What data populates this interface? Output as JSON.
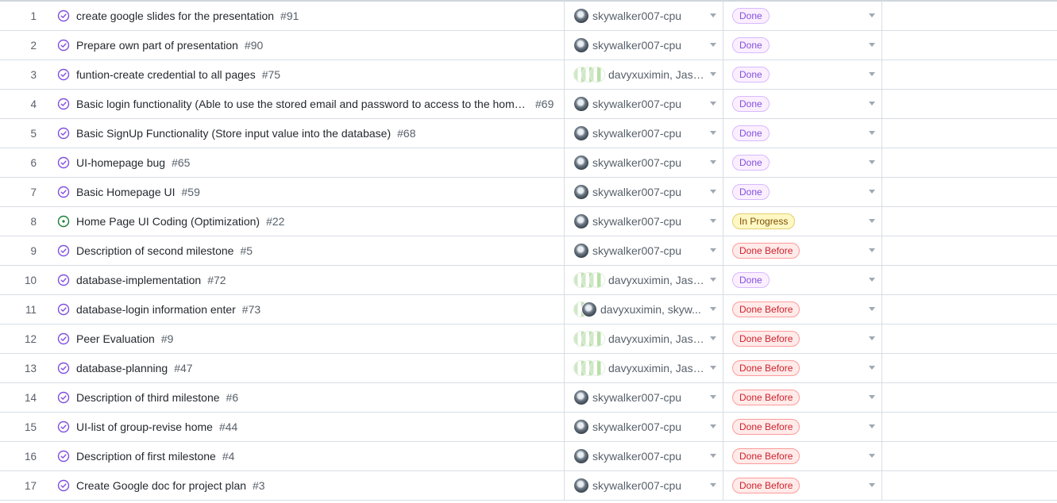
{
  "colors": {
    "done_bg": "#fbefff",
    "done_border": "#d8b9ff",
    "done_text": "#8250df",
    "progress_bg": "#fff8c5",
    "progress_border": "#e3cf6b",
    "progress_text": "#7d4e00",
    "before_bg": "#ffebe9",
    "before_border": "#ff9b9b",
    "before_text": "#cf222e",
    "closed_icon": "#8250df",
    "open_icon": "#1a7f37"
  },
  "rows": [
    {
      "num": "1",
      "title": "create google slides for the presentation",
      "issue": "#91",
      "state": "closed",
      "avatar": "sky",
      "assignee": "skywalker007-cpu",
      "status": "Done",
      "status_key": "done"
    },
    {
      "num": "2",
      "title": "Prepare own part of presentation",
      "issue": "#90",
      "state": "closed",
      "avatar": "sky",
      "assignee": "skywalker007-cpu",
      "status": "Done",
      "status_key": "done"
    },
    {
      "num": "3",
      "title": "funtion-create credential to all pages",
      "issue": "#75",
      "state": "closed",
      "avatar": "davy-multi",
      "assignee": "davyxuximin, Jases...",
      "status": "Done",
      "status_key": "done"
    },
    {
      "num": "4",
      "title": "Basic login functionality (Able to use the stored email and password to access to the home...",
      "issue": "#69",
      "state": "closed",
      "avatar": "sky",
      "assignee": "skywalker007-cpu",
      "status": "Done",
      "status_key": "done"
    },
    {
      "num": "5",
      "title": "Basic SignUp Functionality (Store input value into the database)",
      "issue": "#68",
      "state": "closed",
      "avatar": "sky",
      "assignee": "skywalker007-cpu",
      "status": "Done",
      "status_key": "done"
    },
    {
      "num": "6",
      "title": "UI-homepage bug",
      "issue": "#65",
      "state": "closed",
      "avatar": "sky",
      "assignee": "skywalker007-cpu",
      "status": "Done",
      "status_key": "done"
    },
    {
      "num": "7",
      "title": "Basic Homepage UI",
      "issue": "#59",
      "state": "closed",
      "avatar": "sky",
      "assignee": "skywalker007-cpu",
      "status": "Done",
      "status_key": "done"
    },
    {
      "num": "8",
      "title": "Home Page UI Coding (Optimization)",
      "issue": "#22",
      "state": "open",
      "avatar": "sky",
      "assignee": "skywalker007-cpu",
      "status": "In Progress",
      "status_key": "progress"
    },
    {
      "num": "9",
      "title": "Description of second milestone",
      "issue": "#5",
      "state": "closed",
      "avatar": "sky",
      "assignee": "skywalker007-cpu",
      "status": "Done Before",
      "status_key": "before"
    },
    {
      "num": "10",
      "title": "database-implementation",
      "issue": "#72",
      "state": "closed",
      "avatar": "davy-multi",
      "assignee": "davyxuximin, Jases...",
      "status": "Done",
      "status_key": "done"
    },
    {
      "num": "11",
      "title": "database-login information enter",
      "issue": "#73",
      "state": "closed",
      "avatar": "davy-sky",
      "assignee": "davyxuximin, skyw...",
      "status": "Done Before",
      "status_key": "before"
    },
    {
      "num": "12",
      "title": "Peer Evaluation",
      "issue": "#9",
      "state": "closed",
      "avatar": "davy-multi",
      "assignee": "davyxuximin, Jases...",
      "status": "Done Before",
      "status_key": "before"
    },
    {
      "num": "13",
      "title": "database-planning",
      "issue": "#47",
      "state": "closed",
      "avatar": "davy-multi",
      "assignee": "davyxuximin, Jases...",
      "status": "Done Before",
      "status_key": "before"
    },
    {
      "num": "14",
      "title": "Description of third milestone",
      "issue": "#6",
      "state": "closed",
      "avatar": "sky",
      "assignee": "skywalker007-cpu",
      "status": "Done Before",
      "status_key": "before"
    },
    {
      "num": "15",
      "title": "UI-list of group-revise home",
      "issue": "#44",
      "state": "closed",
      "avatar": "sky",
      "assignee": "skywalker007-cpu",
      "status": "Done Before",
      "status_key": "before"
    },
    {
      "num": "16",
      "title": "Description of first milestone",
      "issue": "#4",
      "state": "closed",
      "avatar": "sky",
      "assignee": "skywalker007-cpu",
      "status": "Done Before",
      "status_key": "before"
    },
    {
      "num": "17",
      "title": "Create Google doc for project plan",
      "issue": "#3",
      "state": "closed",
      "avatar": "sky",
      "assignee": "skywalker007-cpu",
      "status": "Done Before",
      "status_key": "before"
    }
  ]
}
